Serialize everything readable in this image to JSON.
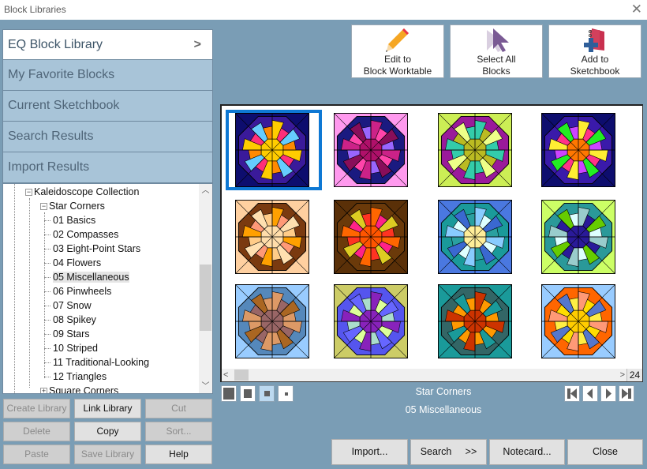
{
  "window": {
    "title": "Block Libraries",
    "close_icon": "close-icon"
  },
  "libraries": [
    {
      "label": "EQ Block Library",
      "active": true
    },
    {
      "label": "My Favorite Blocks"
    },
    {
      "label": "Current Sketchbook"
    },
    {
      "label": "Search Results"
    },
    {
      "label": "Import Results"
    }
  ],
  "tree": {
    "collection": "Kaleidoscope Collection",
    "group": "Star Corners",
    "items": [
      "01 Basics",
      "02 Compasses",
      "03 Eight-Point Stars",
      "04 Flowers",
      "05 Miscellaneous",
      "06 Pinwheels",
      "07 Snow",
      "08 Spikey",
      "09 Stars",
      "10 Striped",
      "11 Traditional-Looking",
      "12 Triangles"
    ],
    "selected": "05 Miscellaneous",
    "next_group": "Square Corners"
  },
  "library_buttons": [
    {
      "label": "Create Library",
      "enabled": false
    },
    {
      "label": "Link Library",
      "enabled": true
    },
    {
      "label": "Cut",
      "enabled": false
    },
    {
      "label": "Delete",
      "enabled": false
    },
    {
      "label": "Copy",
      "enabled": true
    },
    {
      "label": "Sort...",
      "enabled": false
    },
    {
      "label": "Paste",
      "enabled": false
    },
    {
      "label": "Save Library",
      "enabled": false
    },
    {
      "label": "Help",
      "enabled": true
    }
  ],
  "toolbar": {
    "edit": {
      "line1": "Edit to",
      "line2": "Block Worktable",
      "icon": "pencil-icon"
    },
    "select_all": {
      "line1": "Select All",
      "line2": "Blocks",
      "icon": "cursor-icon"
    },
    "add": {
      "line1": "Add to",
      "line2": "Sketchbook",
      "icon": "sketchbook-add-icon"
    }
  },
  "blocks": [
    {
      "bg": "#0d0d6e",
      "ring": "#3a1a9a",
      "a": "#ffcc00",
      "b": "#ff2f7a",
      "c": "#66ccff",
      "d": "#ff8a00",
      "center": "#ffcc00",
      "selected": true
    },
    {
      "bg": "#ff99ee",
      "ring": "#1a1a80",
      "a": "#cc2288",
      "b": "#ff44aa",
      "c": "#880e5a",
      "d": "#9966ff",
      "center": "#b0106a"
    },
    {
      "bg": "#ccee55",
      "ring": "#9a1a9a",
      "a": "#33ccaa",
      "b": "#bbbb22",
      "c": "#eeff88",
      "d": "#33ccaa",
      "center": "#bbbb22"
    },
    {
      "bg": "#0d0d6e",
      "ring": "#3a1aaa",
      "a": "#ffee33",
      "b": "#ff3388",
      "c": "#22ee22",
      "d": "#cc44ff",
      "center": "#ff7700"
    },
    {
      "bg": "#ffd0a0",
      "ring": "#7a3a10",
      "a": "#ffa000",
      "b": "#ff9977",
      "c": "#ffe0b0",
      "d": "#ffcc88",
      "center": "#ffddaa"
    },
    {
      "bg": "#5a3008",
      "ring": "#6b3a0a",
      "a": "#ff6600",
      "b": "#ff2288",
      "c": "#ddcc22",
      "d": "#ff3322",
      "center": "#ff5500"
    },
    {
      "bg": "#4a78e0",
      "ring": "#1a9a9a",
      "a": "#88ccff",
      "b": "#ddffff",
      "c": "#3a68d0",
      "d": "#2aa0a0",
      "center": "#ffee99"
    },
    {
      "bg": "#ccff66",
      "ring": "#2a9999",
      "a": "#99cccc",
      "b": "#2a1a99",
      "c": "#66cc00",
      "d": "#ddffff",
      "center": "#2a1a99"
    },
    {
      "bg": "#99ccff",
      "ring": "#5588bb",
      "a": "#dd9966",
      "b": "#996666",
      "c": "#aa6622",
      "d": "#dd9966",
      "center": "#996666"
    },
    {
      "bg": "#cccc66",
      "ring": "#5555ee",
      "a": "#8822bb",
      "b": "#ddff99",
      "c": "#6666ff",
      "d": "#aaddcc",
      "center": "#8822bb"
    },
    {
      "bg": "#1a9a9a",
      "ring": "#336666",
      "a": "#cc3300",
      "b": "#ff9900",
      "c": "#1a9a9a",
      "d": "#ff9900",
      "center": "#cc3300"
    },
    {
      "bg": "#99ccff",
      "ring": "#ff6600",
      "a": "#ff9977",
      "b": "#ffdd00",
      "c": "#5577cc",
      "d": "#ffee44",
      "center": "#ffcc00"
    }
  ],
  "blocks_count": "24",
  "view_sizes": [
    {
      "name": "size-large-button"
    },
    {
      "name": "size-medium-button"
    },
    {
      "name": "size-small-button",
      "active": true
    },
    {
      "name": "size-tiny-button"
    }
  ],
  "caption": {
    "line1": "Star Corners",
    "line2": "05 Miscellaneous"
  },
  "nav": [
    "first-page-button",
    "prev-page-button",
    "next-page-button",
    "last-page-button"
  ],
  "bottom_buttons": {
    "import": "Import...",
    "search": "Search     >>",
    "notecard": "Notecard...",
    "close": "Close"
  }
}
